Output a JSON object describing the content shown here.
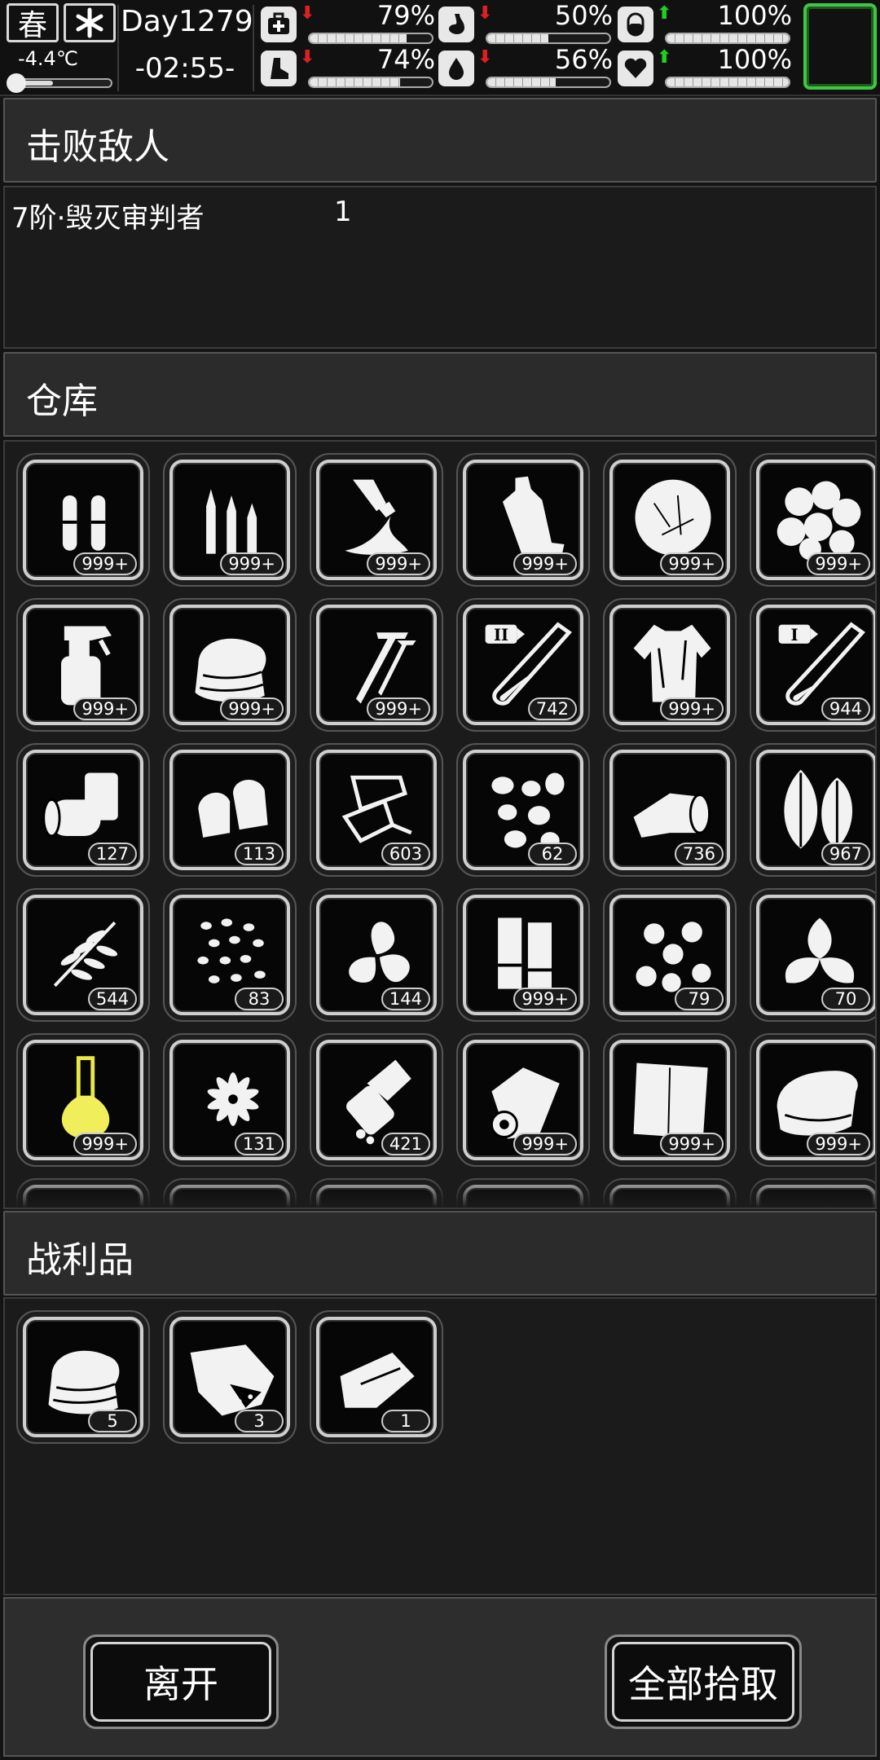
{
  "status": {
    "season": "春",
    "weather_icon": "snowflake-icon",
    "temperature": "-4.4℃",
    "day": "Day1279",
    "time": "-02:55-",
    "stats": [
      {
        "icon": "medkit-icon",
        "trend": "down",
        "value": "79%",
        "level": 0.79
      },
      {
        "icon": "stomach-icon",
        "trend": "down",
        "value": "50%",
        "level": 0.5
      },
      {
        "icon": "pill-icon",
        "trend": "up",
        "value": "100%",
        "level": 1.0
      },
      {
        "icon": "foot-icon",
        "trend": "down",
        "value": "74%",
        "level": 0.74
      },
      {
        "icon": "water-drop-icon",
        "trend": "down",
        "value": "56%",
        "level": 0.56
      },
      {
        "icon": "heart-icon",
        "trend": "up",
        "value": "100%",
        "level": 1.0
      }
    ],
    "accent": "#3fc83f"
  },
  "defeated": {
    "title": "击败敌人",
    "enemies": [
      {
        "name": "7阶·毁灭审判者",
        "count": "1"
      }
    ]
  },
  "storage": {
    "title": "仓库",
    "items": [
      {
        "icon": "pistol-bullets-icon",
        "count": "999+"
      },
      {
        "icon": "rifle-bullets-icon",
        "count": "999+"
      },
      {
        "icon": "glue-tube-icon",
        "count": "999+"
      },
      {
        "icon": "plastic-bottle-icon",
        "count": "999+"
      },
      {
        "icon": "cotton-ball-icon",
        "count": "999+"
      },
      {
        "icon": "cotton-bolls-icon",
        "count": "999+"
      },
      {
        "icon": "spray-bottle-icon",
        "count": "999+"
      },
      {
        "icon": "folded-cloth-icon",
        "count": "999+"
      },
      {
        "icon": "screws-icon",
        "count": "999+"
      },
      {
        "icon": "test-tube-ii-icon",
        "count": "742"
      },
      {
        "icon": "torn-shirt-icon",
        "count": "999+"
      },
      {
        "icon": "test-tube-i-icon",
        "count": "944"
      },
      {
        "icon": "cans-icon",
        "count": "127"
      },
      {
        "icon": "bullet-tips-icon",
        "count": "113"
      },
      {
        "icon": "paper-scraps-icon",
        "count": "603"
      },
      {
        "icon": "seeds-icon",
        "count": "62"
      },
      {
        "icon": "bandage-roll-icon",
        "count": "736"
      },
      {
        "icon": "leaves-icon",
        "count": "967"
      },
      {
        "icon": "fern-icon",
        "count": "544"
      },
      {
        "icon": "beans-icon",
        "count": "83"
      },
      {
        "icon": "herb-leaves-icon",
        "count": "144"
      },
      {
        "icon": "battery-sticks-icon",
        "count": "999+"
      },
      {
        "icon": "berries-icon",
        "count": "79"
      },
      {
        "icon": "mint-icon",
        "count": "70"
      },
      {
        "icon": "yellow-flask-icon",
        "count": "999+"
      },
      {
        "icon": "flower-icon",
        "count": "131"
      },
      {
        "icon": "pill-bottle-icon",
        "count": "421"
      },
      {
        "icon": "paper-roll-icon",
        "count": "999+"
      },
      {
        "icon": "paper-sheet-icon",
        "count": "999+"
      },
      {
        "icon": "towel-icon",
        "count": "999+"
      }
    ]
  },
  "loot": {
    "title": "战利品",
    "items": [
      {
        "icon": "folded-cloth-icon",
        "count": "5"
      },
      {
        "icon": "meat-chunk-icon",
        "count": "3"
      },
      {
        "icon": "cloth-scraps-icon",
        "count": "1"
      }
    ]
  },
  "footer": {
    "leave_label": "离开",
    "take_all_label": "全部拾取"
  }
}
